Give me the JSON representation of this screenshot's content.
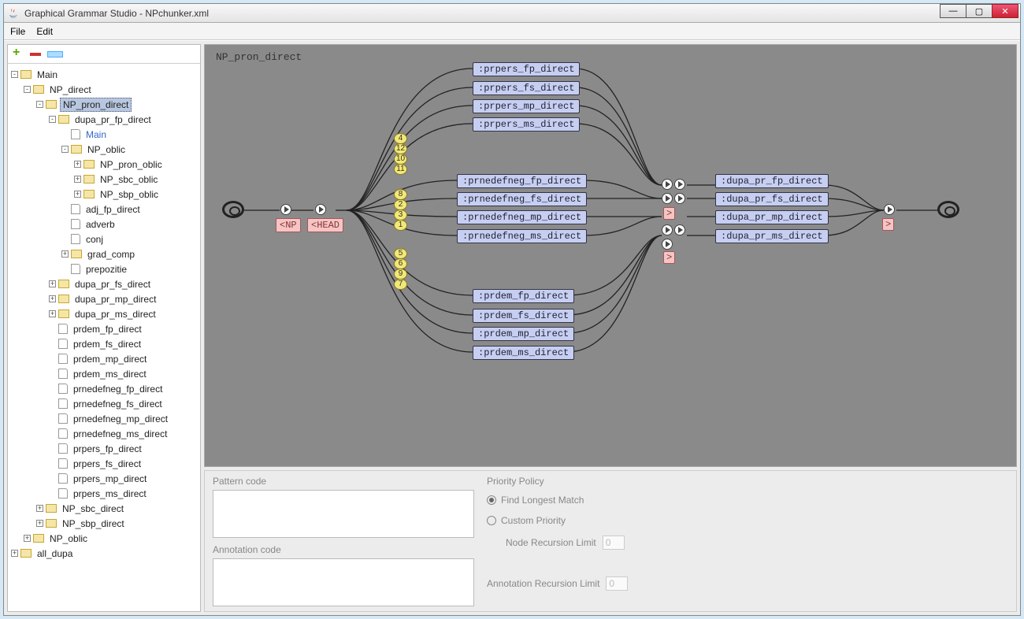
{
  "window": {
    "title": "Graphical Grammar Studio - NPchunker.xml"
  },
  "menu": {
    "file": "File",
    "edit": "Edit"
  },
  "toolbar": {
    "add": "add",
    "del": "delete",
    "ren": "rename"
  },
  "tree": {
    "main": "Main",
    "np_direct": "NP_direct",
    "np_pron_direct": "NP_pron_direct",
    "dupa_pr_fp_direct": "dupa_pr_fp_direct",
    "main2": "Main",
    "np_oblic": "NP_oblic",
    "np_pron_oblic": "NP_pron_oblic",
    "np_sbc_oblic": "NP_sbc_oblic",
    "np_sbp_oblic": "NP_sbp_oblic",
    "adj_fp_direct": "adj_fp_direct",
    "adverb": "adverb",
    "conj": "conj",
    "grad_comp": "grad_comp",
    "prepozitie": "prepozitie",
    "dupa_pr_fs_direct": "dupa_pr_fs_direct",
    "dupa_pr_mp_direct": "dupa_pr_mp_direct",
    "dupa_pr_ms_direct": "dupa_pr_ms_direct",
    "prdem_fp_direct": "prdem_fp_direct",
    "prdem_fs_direct": "prdem_fs_direct",
    "prdem_mp_direct": "prdem_mp_direct",
    "prdem_ms_direct": "prdem_ms_direct",
    "prnedefneg_fp_direct": "prnedefneg_fp_direct",
    "prnedefneg_fs_direct": "prnedefneg_fs_direct",
    "prnedefneg_mp_direct": "prnedefneg_mp_direct",
    "prnedefneg_ms_direct": "prnedefneg_ms_direct",
    "prpers_fp_direct": "prpers_fp_direct",
    "prpers_fs_direct": "prpers_fs_direct",
    "prpers_mp_direct": "prpers_mp_direct",
    "prpers_ms_direct": "prpers_ms_direct",
    "np_sbc_direct": "NP_sbc_direct",
    "np_sbp_direct": "NP_sbp_direct",
    "np_oblic2": "NP_oblic",
    "all_dupa": "all_dupa"
  },
  "canvas": {
    "title": "NP_pron_direct",
    "tag_np": "<NP",
    "tag_head": "<HEAD",
    "tag_gt": ">",
    "n1": ":prpers_fp_direct",
    "n2": ":prpers_fs_direct",
    "n3": ":prpers_mp_direct",
    "n4": ":prpers_ms_direct",
    "n5": ":prnedefneg_fp_direct",
    "n6": ":prnedefneg_fs_direct",
    "n7": ":prnedefneg_mp_direct",
    "n8": ":prnedefneg_ms_direct",
    "n9": ":prdem_fp_direct",
    "n10": ":prdem_fs_direct",
    "n11": ":prdem_mp_direct",
    "n12": ":prdem_ms_direct",
    "d1": ":dupa_pr_fp_direct",
    "d2": ":dupa_pr_fs_direct",
    "d3": ":dupa_pr_mp_direct",
    "d4": ":dupa_pr_ms_direct",
    "priorities_top": [
      "4",
      "12",
      "10",
      "11"
    ],
    "priorities_mid": [
      "8",
      "2",
      "3",
      "1"
    ],
    "priorities_bot": [
      "5",
      "6",
      "9",
      "7"
    ]
  },
  "props": {
    "pattern_label": "Pattern code",
    "annotation_label": "Annotation code",
    "priority_label": "Priority Policy",
    "find_longest": "Find Longest Match",
    "custom_priority": "Custom Priority",
    "node_recursion": "Node Recursion Limit",
    "annotation_recursion": "Annotation Recursion Limit",
    "limit_value": "0"
  }
}
